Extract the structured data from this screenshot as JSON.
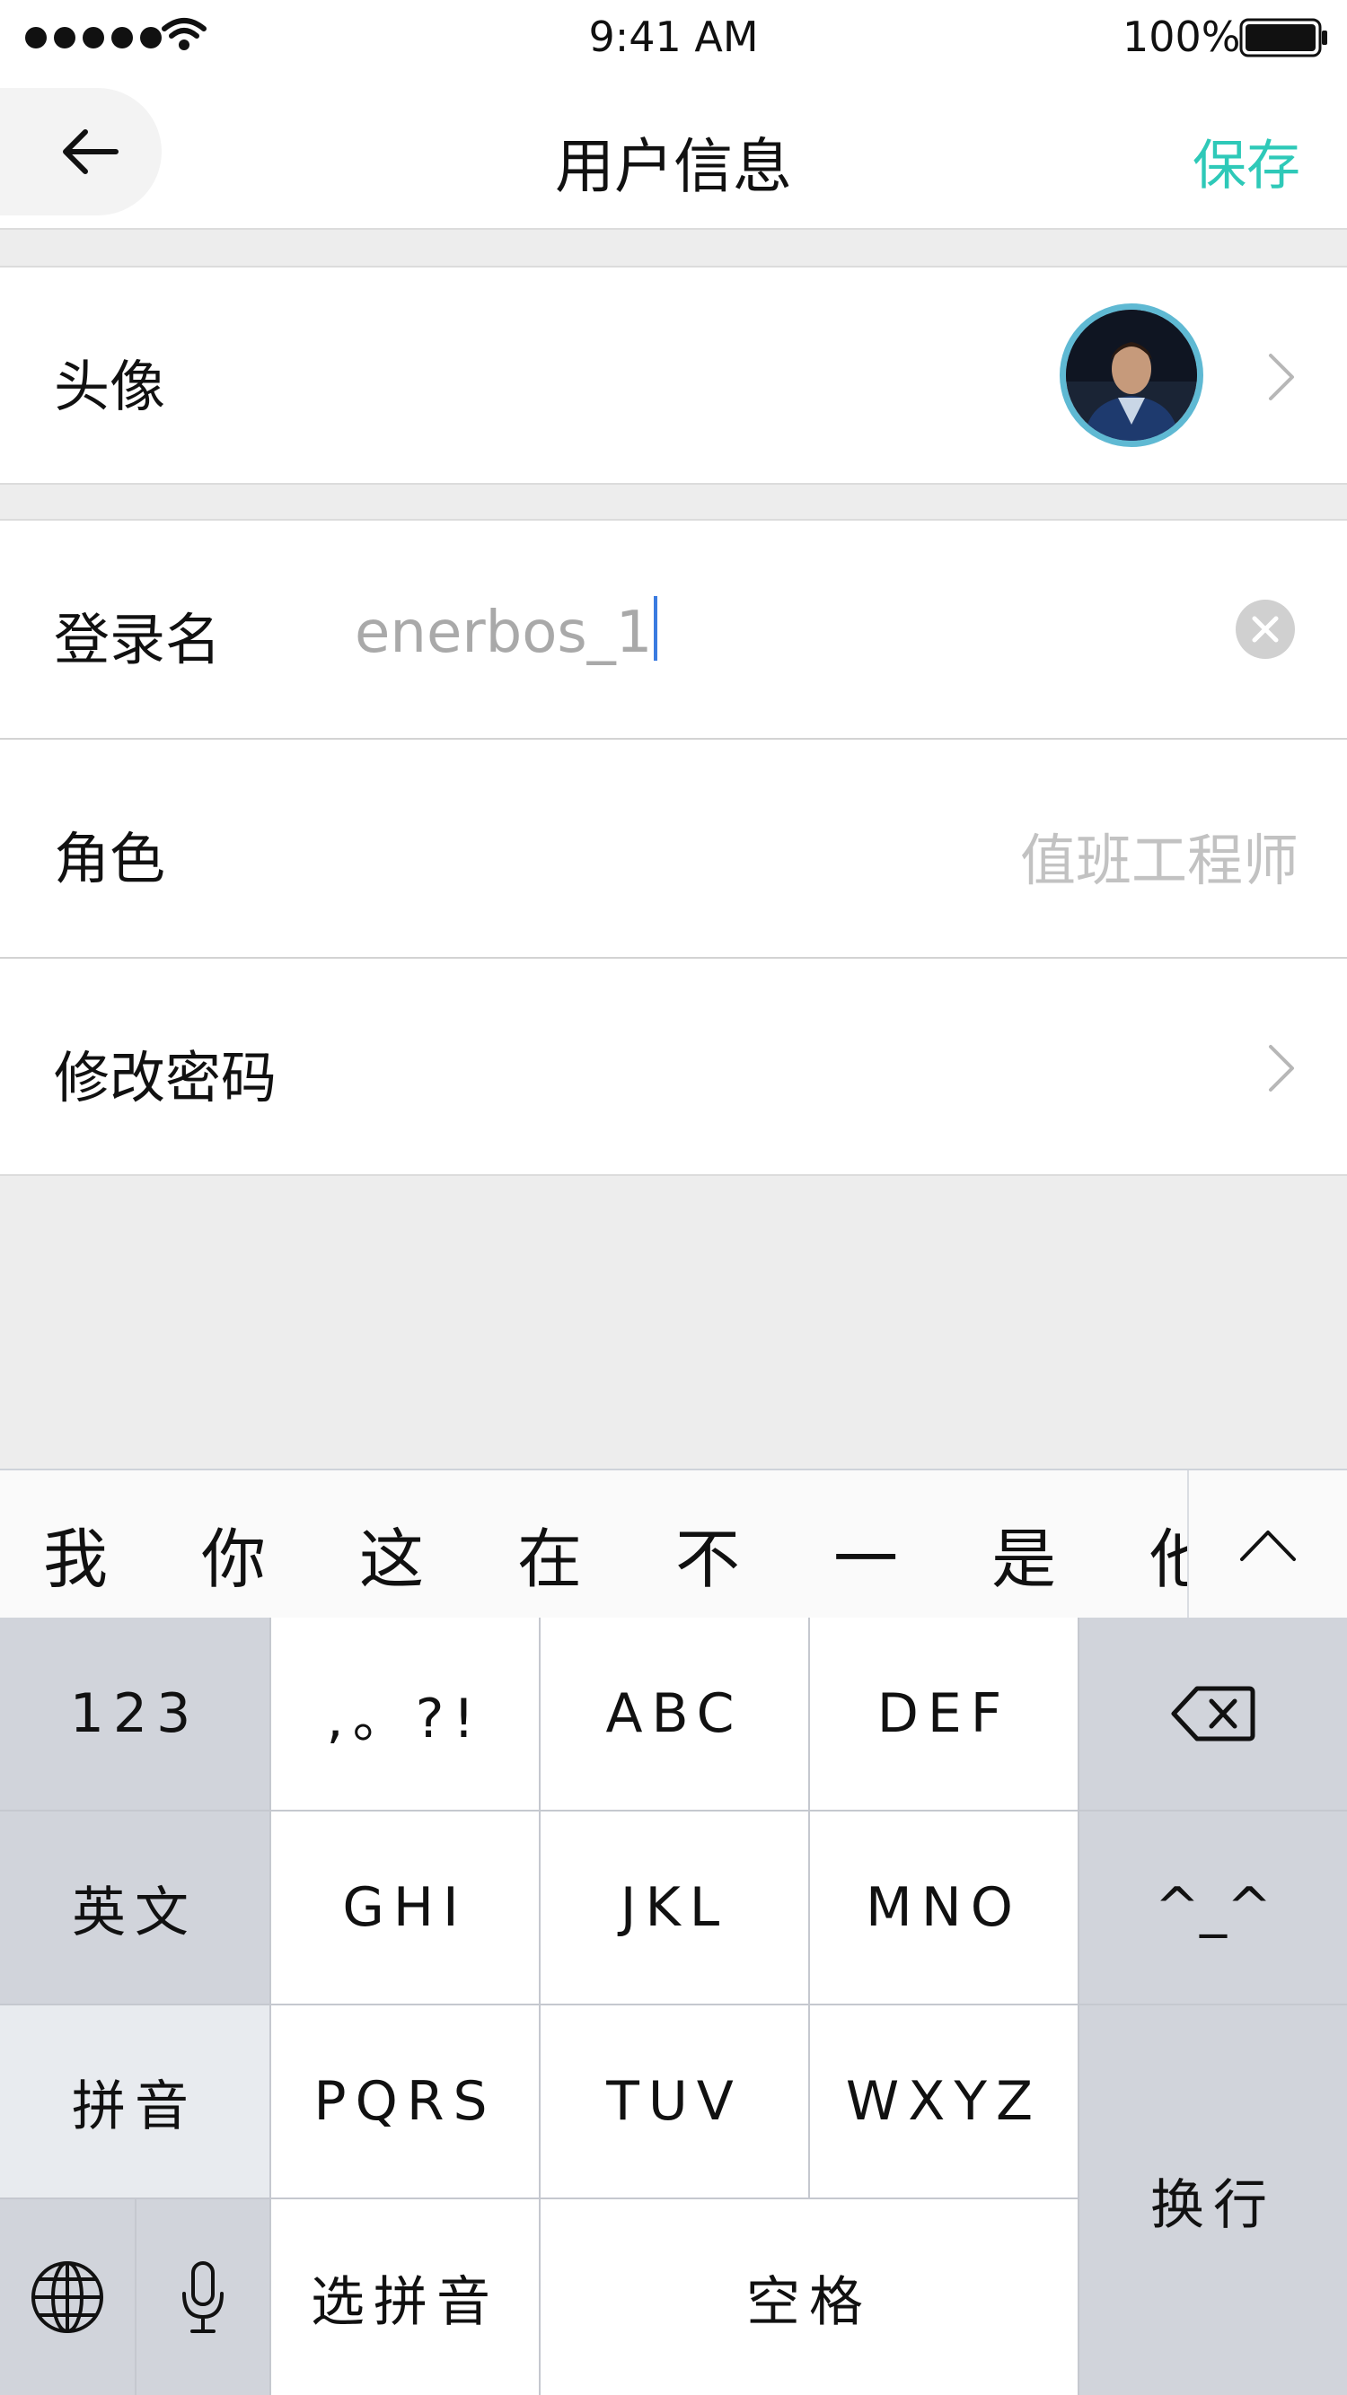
{
  "status_bar": {
    "time": "9:41 AM",
    "battery": "100%",
    "signal_icon": "signal-dots-icon",
    "wifi_icon": "wifi-icon",
    "battery_icon": "battery-icon"
  },
  "nav": {
    "title": "用户信息",
    "save_label": "保存",
    "back_icon": "arrow-left-icon",
    "accent_color": "#2ec9b8"
  },
  "rows": {
    "avatar": {
      "label": "头像",
      "icon": "chevron-right-icon"
    },
    "login": {
      "label": "登录名",
      "value": "enerbos_1",
      "clear_icon": "clear-circle-icon"
    },
    "role": {
      "label": "角色",
      "value": "值班工程师"
    },
    "password": {
      "label": "修改密码",
      "icon": "chevron-right-icon"
    }
  },
  "keyboard": {
    "candidates": [
      "我",
      "你",
      "这",
      "在",
      "不",
      "一",
      "是",
      "他"
    ],
    "collapse_icon": "chevron-up-icon",
    "keys": {
      "num": "123",
      "punct": ",。?!",
      "abc": "ABC",
      "def": "DEF",
      "backspace_icon": "backspace-icon",
      "english": "英文",
      "ghi": "GHI",
      "jkl": "JKL",
      "mno": "MNO",
      "emoji": "^_^",
      "pinyin": "拼音",
      "pqrs": "PQRS",
      "tuv": "TUV",
      "wxyz": "WXYZ",
      "enter": "换行",
      "globe_icon": "globe-icon",
      "mic_icon": "microphone-icon",
      "select_pinyin": "选拼音",
      "space": "空格"
    }
  }
}
